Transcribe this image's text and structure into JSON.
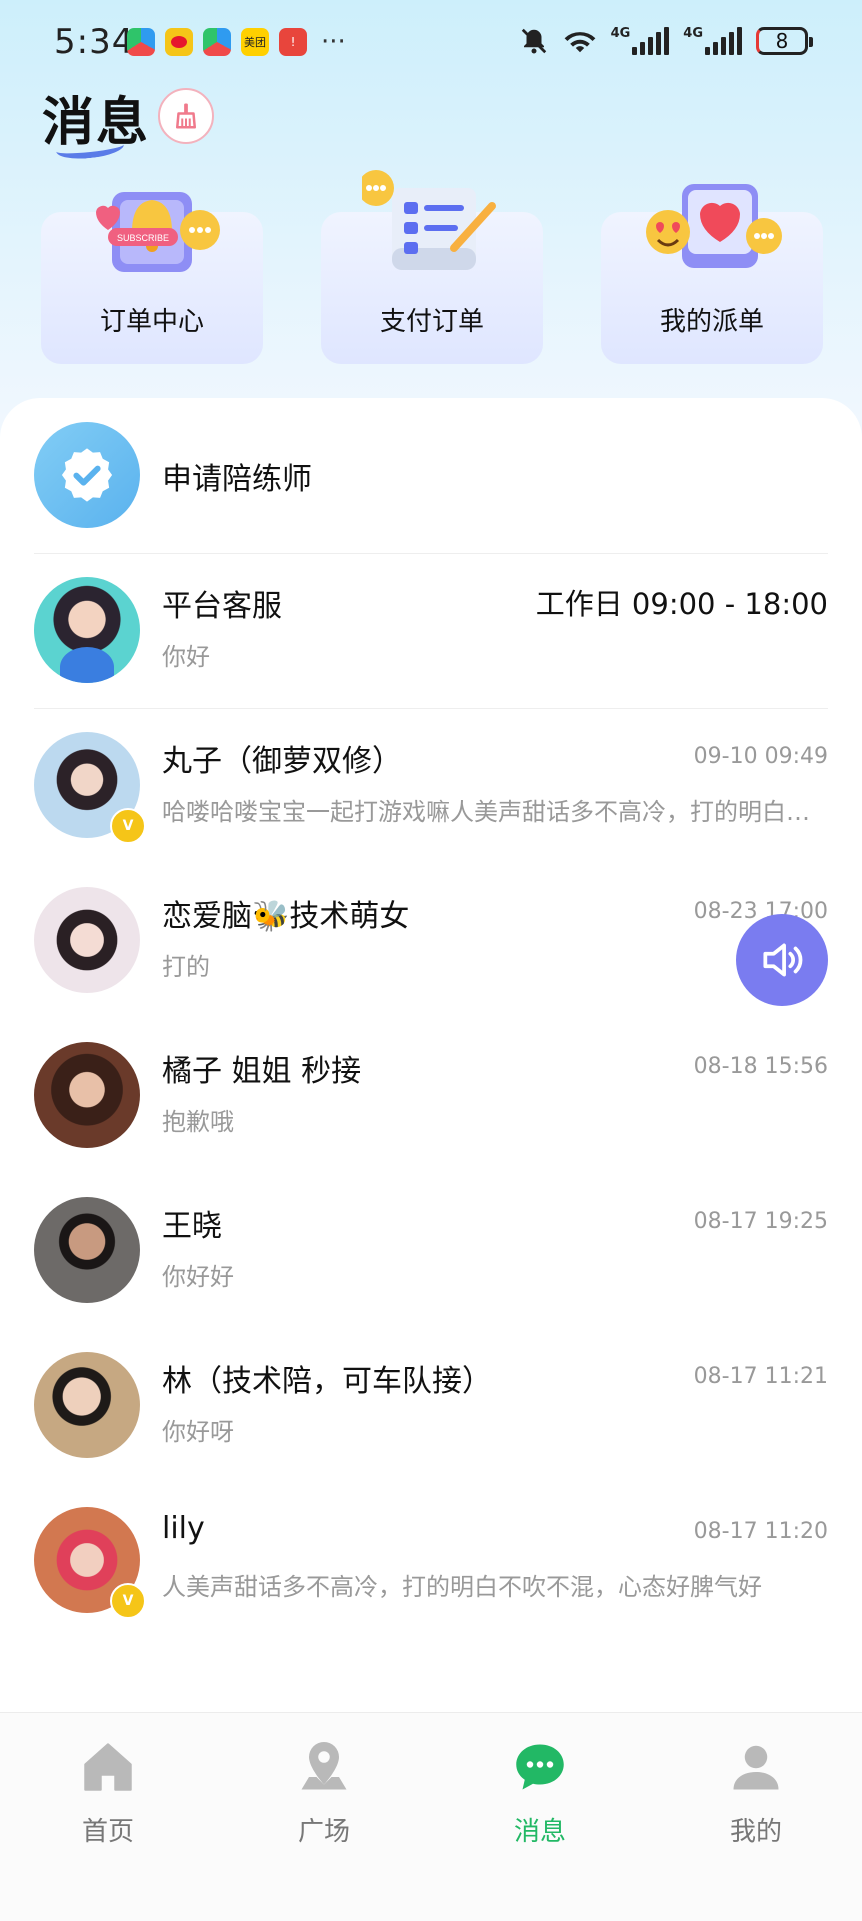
{
  "status_bar": {
    "time": "5:34",
    "app_icons": [
      "browser-icon",
      "weibo-icon",
      "browser-icon",
      "meituan-icon",
      "app-icon"
    ],
    "meituan_label": "美团",
    "network_1": "4G",
    "network_2": "4G",
    "battery": "8"
  },
  "header": {
    "title": "消息"
  },
  "quick_actions": [
    {
      "label": "订单中心",
      "icon": "bell-icon"
    },
    {
      "label": "支付订单",
      "icon": "checklist-icon"
    },
    {
      "label": "我的派单",
      "icon": "heart-icon"
    }
  ],
  "apply": {
    "label": "申请陪练师"
  },
  "conversations": [
    {
      "name": "平台客服",
      "time": "工作日 09:00 - 18:00",
      "message": "你好"
    },
    {
      "name": "丸子（御萝双修）",
      "time": "09-10 09:49",
      "message": "哈喽哈喽宝宝一起打游戏嘛人美声甜话多不高冷，打的明白不吹不混",
      "badge": "V"
    },
    {
      "name": "恋爱脑🐝技术萌女",
      "time": "08-23 17:00",
      "message": "打的"
    },
    {
      "name": "橘子 姐姐 秒接",
      "time": "08-18 15:56",
      "message": "抱歉哦"
    },
    {
      "name": "王晓",
      "time": "08-17 19:25",
      "message": "你好好"
    },
    {
      "name": "林（技术陪，可车队接）",
      "time": "08-17 11:21",
      "message": "你好呀"
    },
    {
      "name": "lily",
      "time": "08-17 11:20",
      "message": "人美声甜话多不高冷，打的明白不吹不混，心态好脾气好",
      "badge": "V"
    }
  ],
  "bottom_nav": [
    {
      "label": "首页",
      "icon": "home-icon",
      "active": false
    },
    {
      "label": "广场",
      "icon": "location-icon",
      "active": false
    },
    {
      "label": "消息",
      "icon": "chat-icon",
      "active": true
    },
    {
      "label": "我的",
      "icon": "user-icon",
      "active": false
    }
  ],
  "colors": {
    "accent": "#22b865",
    "speaker": "#7a7cf0",
    "verify": "#6cc3f2"
  }
}
